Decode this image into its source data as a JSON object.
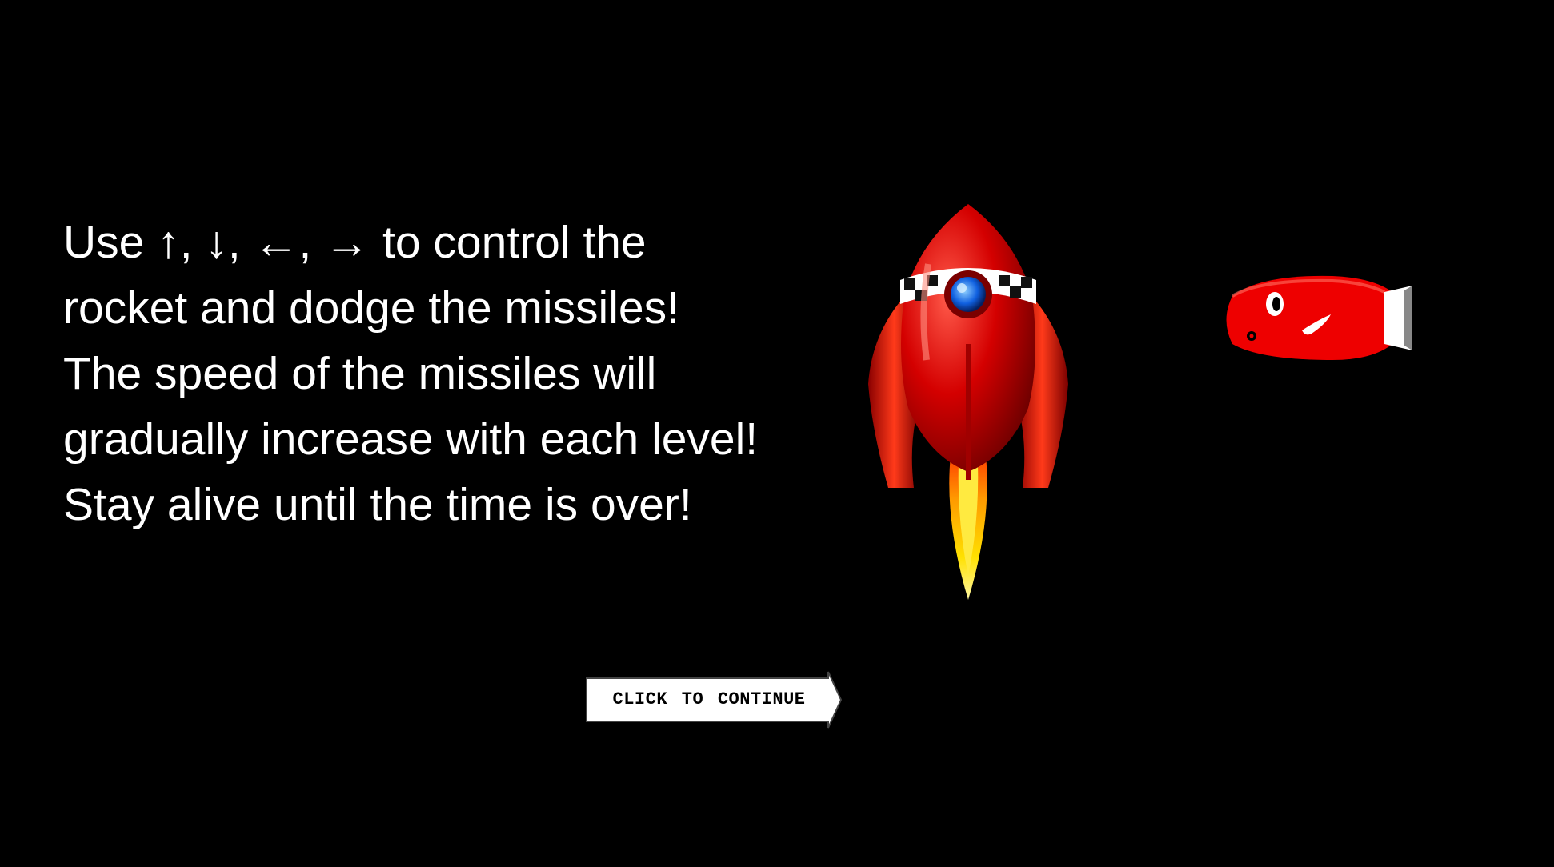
{
  "instructions": {
    "text": "Use ↑, ↓, ←, → to control the rocket and dodge the missiles! The speed of the missiles will gradually increase with each level! Stay alive until the time is over!"
  },
  "continue_button": {
    "label": "CLICK TO CONTINUE"
  },
  "sprites": {
    "rocket": "rocket-icon",
    "missile": "missile-icon"
  },
  "colors": {
    "background": "#000000",
    "text": "#ffffff",
    "rocket_body": "#d40000",
    "flame": "#ffd000",
    "missile_body": "#ee0000",
    "button_fill": "#ffffff"
  }
}
